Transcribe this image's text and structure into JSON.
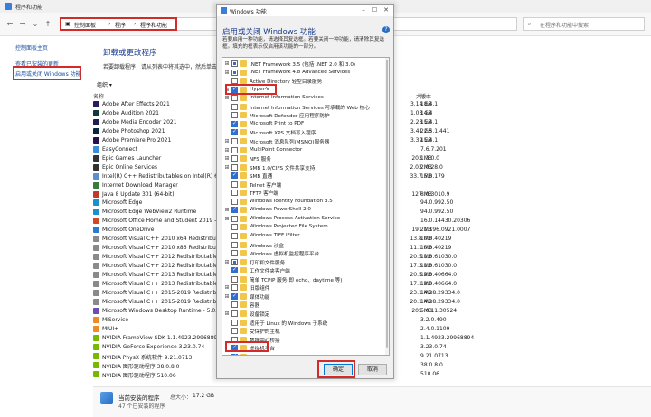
{
  "window": {
    "title": "程序和功能"
  },
  "address": {
    "crumbs": [
      "控制面板",
      "程序",
      "程序和功能"
    ],
    "search_placeholder": "在程序和功能中搜索"
  },
  "left_pane": {
    "home": "控制面板主页",
    "updates": "查看已安装的更新",
    "features": "启用或关闭 Windows 功能"
  },
  "main": {
    "heading": "卸载或更改程序",
    "description": "若要卸载程序，请从列表中将其选中，然后单击“卸载”、“更改”或“修复”。",
    "organize": "组织 ▾",
    "columns": {
      "name": "名称",
      "size": "大小",
      "version": "版本"
    }
  },
  "programs": [
    {
      "name": "Adobe After Effects 2021",
      "size": "3.14 GB",
      "version": "18.4.1",
      "color": "#2a1a66"
    },
    {
      "name": "Adobe Audition 2021",
      "size": "1.03 GB",
      "version": "14.4",
      "color": "#0f3b3b"
    },
    {
      "name": "Adobe Media Encoder 2021",
      "size": "2.28 GB",
      "version": "15.4.1",
      "color": "#1f1f52"
    },
    {
      "name": "Adobe Photoshop 2021",
      "size": "3.41 GB",
      "version": "22.5.1.441",
      "color": "#0a2740"
    },
    {
      "name": "Adobe Premiere Pro 2021",
      "size": "3.39 GB",
      "version": "15.4.1",
      "color": "#24124d"
    },
    {
      "name": "EasyConnect",
      "size": "",
      "version": "7.6.7.201",
      "color": "#3a8fd8"
    },
    {
      "name": "Epic Games Launcher",
      "size": "203 MB",
      "version": "1.3.0.0",
      "color": "#333333"
    },
    {
      "name": "Epic Online Services",
      "size": "2.03 MB",
      "version": "2.0.28.0",
      "color": "#333333"
    },
    {
      "name": "Intel(R) C++ Redistributables on Intel(R) 64",
      "size": "33.7 MB",
      "version": "15.0.179",
      "color": "#5a8ed0"
    },
    {
      "name": "Internet Download Manager",
      "size": "",
      "version": "",
      "color": "#3a7a3a"
    },
    {
      "name": "Java 8 Update 301 (64-bit)",
      "size": "127 MB",
      "version": "8.0.3010.9",
      "color": "#c0392b"
    },
    {
      "name": "Microsoft Edge",
      "size": "",
      "version": "94.0.992.50",
      "color": "#1b8fd0"
    },
    {
      "name": "Microsoft Edge WebView2 Runtime",
      "size": "",
      "version": "94.0.992.50",
      "color": "#1b8fd0"
    },
    {
      "name": "Microsoft Office Home and Student 2019 - zh",
      "size": "",
      "version": "16.0.14430.20306",
      "color": "#d24726"
    },
    {
      "name": "Microsoft OneDrive",
      "size": "191 MB",
      "version": "21.196.0921.0007",
      "color": "#2a7bd4"
    },
    {
      "name": "Microsoft Visual C++ 2010  x64 Redistributable",
      "size": "13.8 MB",
      "version": "10.0.40219",
      "color": "#8a8a8a"
    },
    {
      "name": "Microsoft Visual C++ 2010  x86 Redistributable",
      "size": "11.1 MB",
      "version": "10.0.40219",
      "color": "#8a8a8a"
    },
    {
      "name": "Microsoft Visual C++ 2012 Redistributable",
      "size": "20.5 MB",
      "version": "11.0.61030.0",
      "color": "#8a8a8a"
    },
    {
      "name": "Microsoft Visual C++ 2012 Redistributable",
      "size": "17.3 MB",
      "version": "11.0.61030.0",
      "color": "#8a8a8a"
    },
    {
      "name": "Microsoft Visual C++ 2013 Redistributable",
      "size": "20.5 MB",
      "version": "12.0.40664.0",
      "color": "#8a8a8a"
    },
    {
      "name": "Microsoft Visual C++ 2013 Redistributable",
      "size": "17.1 MB",
      "version": "12.0.40664.0",
      "color": "#8a8a8a"
    },
    {
      "name": "Microsoft Visual C++ 2015-2019 Redistributable",
      "size": "23.1 MB",
      "version": "14.28.29334.0",
      "color": "#8a8a8a"
    },
    {
      "name": "Microsoft Visual C++ 2015-2019 Redistributable",
      "size": "20.1 MB",
      "version": "14.28.29334.0",
      "color": "#8a8a8a"
    },
    {
      "name": "Microsoft Windows Desktop Runtime - 5.0.11",
      "size": "205 MB",
      "version": "5.0.11.30524",
      "color": "#6a4fb0"
    },
    {
      "name": "MiService",
      "size": "",
      "version": "3.2.0.490",
      "color": "#f08a24"
    },
    {
      "name": "MIUI+",
      "size": "",
      "version": "2.4.0.1109",
      "color": "#f08a24"
    },
    {
      "name": "NVIDIA FrameView SDK 1.1.4923.29968894",
      "size": "",
      "version": "1.1.4923.29968894",
      "color": "#76b900"
    },
    {
      "name": "NVIDIA GeForce Experience 3.23.0.74",
      "size": "",
      "version": "3.23.0.74",
      "color": "#76b900"
    },
    {
      "name": "NVIDIA PhysX 系统软件 9.21.0713",
      "size": "",
      "version": "9.21.0713",
      "color": "#76b900"
    },
    {
      "name": "NVIDIA 图形驱动程序 38.0.8.0",
      "size": "",
      "version": "38.0.8.0",
      "color": "#76b900"
    },
    {
      "name": "NVIDIA 图形驱动程序 510.06",
      "size": "",
      "version": "510.06",
      "color": "#76b900"
    }
  ],
  "bottom": {
    "title": "当前安装的程序",
    "total_label": "总大小：",
    "total": "17.2 GB",
    "count": "47 个已安装的程序"
  },
  "dialog": {
    "title": "Windows 功能",
    "heading": "启用或关闭 Windows 功能",
    "description": "若要启用一种功能，请选择其复选框。若要关闭一种功能，请清除其复选框。填充的框表示仅启用该功能的一部分。",
    "help": "?",
    "ok": "确定",
    "cancel": "取消",
    "features": [
      {
        "label": ".NET Framework 3.5 (包括 .NET 2.0 和 3.0)",
        "state": "partial",
        "expand": true
      },
      {
        "label": ".NET Framework 4.8 Advanced Services",
        "state": "partial",
        "expand": true
      },
      {
        "label": "Active Directory 轻型目录服务",
        "state": "unchecked",
        "expand": false
      },
      {
        "label": "Hyper-V",
        "state": "checked",
        "expand": true
      },
      {
        "label": "Internet Information Services",
        "state": "unchecked",
        "expand": true
      },
      {
        "label": "Internet Information Services 可承载的 Web 核心",
        "state": "unchecked",
        "expand": false
      },
      {
        "label": "Microsoft Defender 应用程序防护",
        "state": "unchecked",
        "expand": false
      },
      {
        "label": "Microsoft Print to PDF",
        "state": "checked",
        "expand": false
      },
      {
        "label": "Microsoft XPS 文档写入程序",
        "state": "checked",
        "expand": false
      },
      {
        "label": "Microsoft 消息队列(MSMQ)服务器",
        "state": "unchecked",
        "expand": true
      },
      {
        "label": "MultiPoint Connector",
        "state": "unchecked",
        "expand": true
      },
      {
        "label": "NFS 服务",
        "state": "unchecked",
        "expand": true
      },
      {
        "label": "SMB 1.0/CIFS 文件共享支持",
        "state": "unchecked",
        "expand": true
      },
      {
        "label": "SMB 直通",
        "state": "checked",
        "expand": false
      },
      {
        "label": "Telnet 客户端",
        "state": "unchecked",
        "expand": false
      },
      {
        "label": "TFTP 客户端",
        "state": "unchecked",
        "expand": false
      },
      {
        "label": "Windows Identity Foundation 3.5",
        "state": "unchecked",
        "expand": false
      },
      {
        "label": "Windows PowerShell 2.0",
        "state": "checked",
        "expand": true
      },
      {
        "label": "Windows Process Activation Service",
        "state": "unchecked",
        "expand": true
      },
      {
        "label": "Windows Projected File System",
        "state": "unchecked",
        "expand": false
      },
      {
        "label": "Windows TIFF IFilter",
        "state": "unchecked",
        "expand": false
      },
      {
        "label": "Windows 沙盒",
        "state": "unchecked",
        "expand": false
      },
      {
        "label": "Windows 虚拟机监控程序平台",
        "state": "unchecked",
        "expand": false
      },
      {
        "label": "打印和文件服务",
        "state": "partial",
        "expand": true
      },
      {
        "label": "工作文件夹客户端",
        "state": "checked",
        "expand": false
      },
      {
        "label": "简单 TCPIP 服务(即 echo、daytime 等)",
        "state": "unchecked",
        "expand": false
      },
      {
        "label": "旧版组件",
        "state": "unchecked",
        "expand": true
      },
      {
        "label": "媒体功能",
        "state": "checked",
        "expand": true
      },
      {
        "label": "容器",
        "state": "unchecked",
        "expand": false
      },
      {
        "label": "设备锁定",
        "state": "unchecked",
        "expand": true
      },
      {
        "label": "适用于 Linux 的 Windows 子系统",
        "state": "unchecked",
        "expand": false
      },
      {
        "label": "受保护的主机",
        "state": "unchecked",
        "expand": false
      },
      {
        "label": "数据中心桥接",
        "state": "unchecked",
        "expand": false
      },
      {
        "label": "虚拟机平台",
        "state": "checked",
        "expand": false
      },
      {
        "label": "远程差分压缩 API 支持",
        "state": "checked",
        "expand": false
      }
    ]
  }
}
